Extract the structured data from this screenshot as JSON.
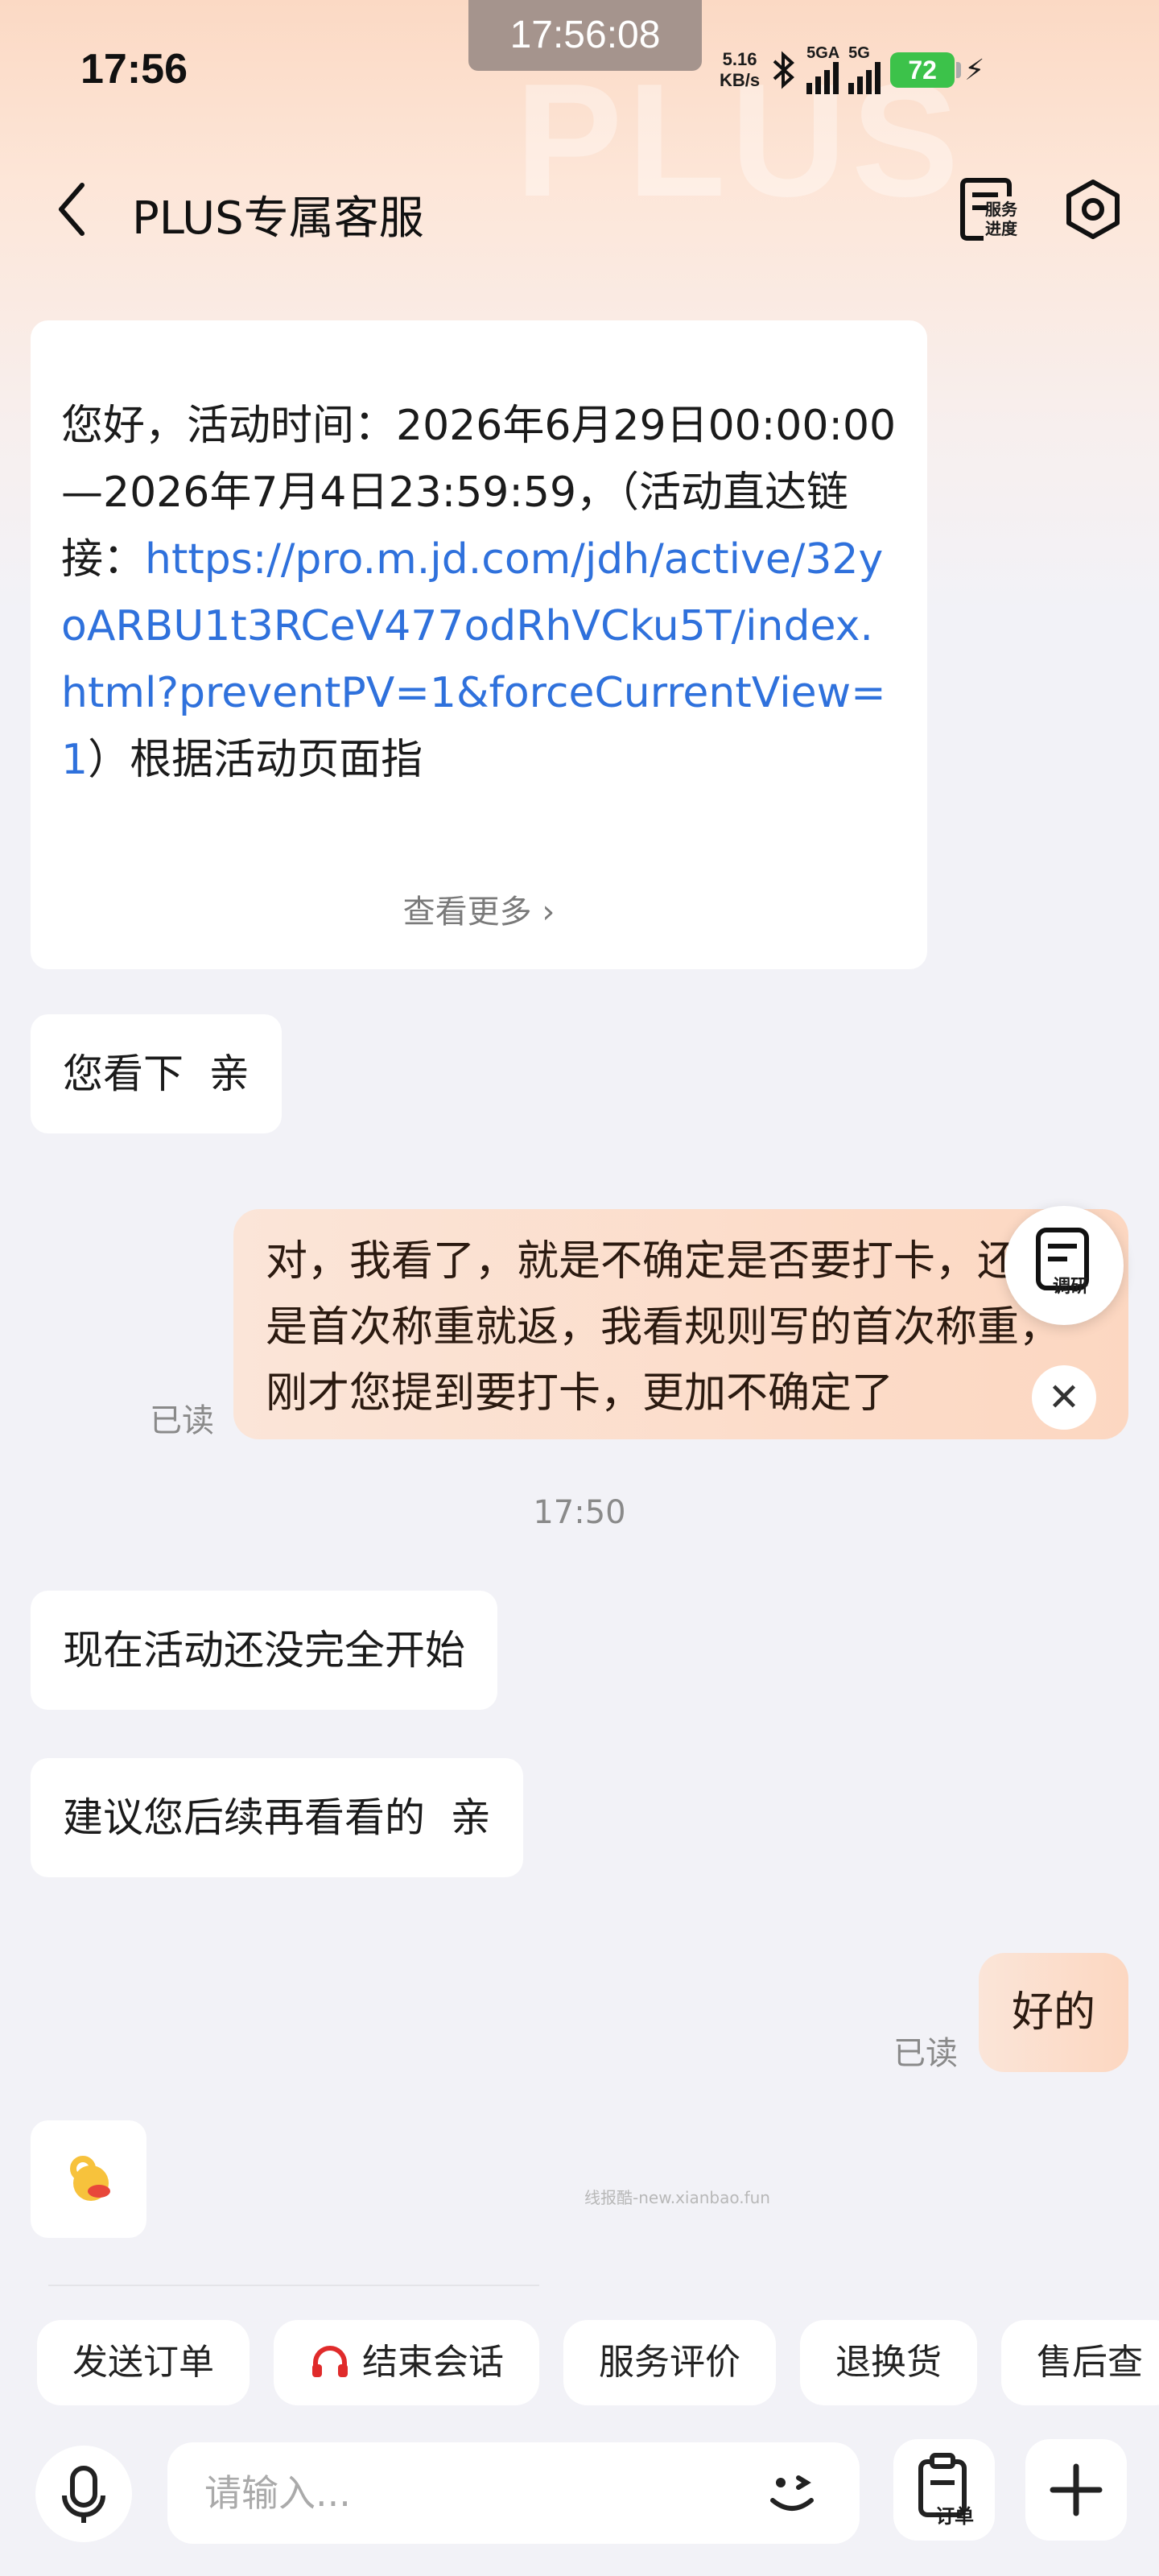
{
  "status_bar": {
    "time": "17:56",
    "clock_overlay": "17:56:08",
    "net_speed_value": "5.16",
    "net_speed_unit": "KB/s",
    "signal1_label": "5GA",
    "signal2_label": "5G",
    "battery": "72",
    "icons": [
      "bluetooth-icon",
      "signal-icon",
      "charging-icon"
    ]
  },
  "header": {
    "title": "PLUS专属客服",
    "service_progress_label_1": "服务",
    "service_progress_label_2": "进度",
    "background_watermark": "PLUS"
  },
  "messages": {
    "m1": {
      "text_before_link": "您好，活动时间：2026年6月29日00:00:00—2026年7月4日23:59:59，（活动直达链接：",
      "link": "https://pro.m.jd.com/jdh/active/32yoARBU1t3RCeV477odRhVCku5T/index.html?preventPV=1&forceCurrentView=1",
      "text_after_link": "）根据活动页面指",
      "see_more": "查看更多"
    },
    "m2": "您看下  亲",
    "m3_sent": "对，我看了，就是不确定是否要打卡，还只是首次称重就返，我看规则写的首次称重，刚才您提到要打卡，更加不确定了",
    "m3_read": "已读",
    "time_separator": "17:50",
    "m4": "现在活动还没完全开始",
    "m5": "建议您后续再看看的  亲",
    "m6_sent": "好的",
    "m6_read": "已读",
    "m7_emoji": "ok-hand-emoji"
  },
  "survey": {
    "label": "调研"
  },
  "watermark_small": "线报酷-new.xianbao.fun",
  "quick_actions": [
    "发送订单",
    "结束会话",
    "服务评价",
    "退换货",
    "售后查"
  ],
  "input": {
    "placeholder": "请输入...",
    "order_label": "订单"
  },
  "colors": {
    "accent_link": "#2f71dc",
    "outgoing_bubble": "#fcd7c1",
    "battery": "#3cc24a",
    "headset_red": "#e02b2b"
  }
}
